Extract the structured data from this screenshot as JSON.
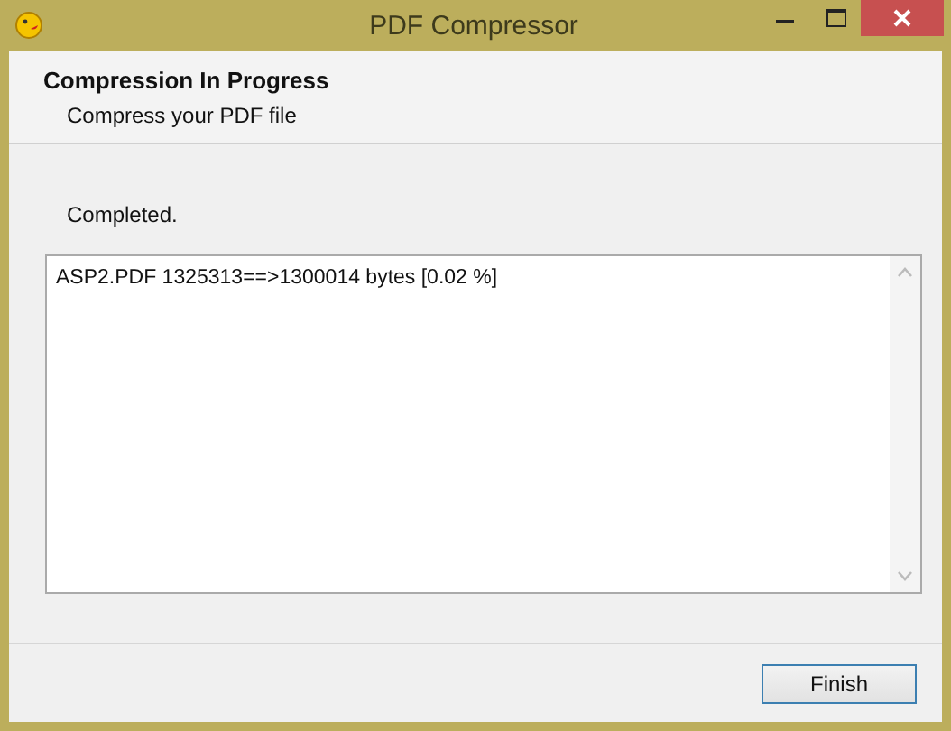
{
  "window": {
    "title": "PDF Compressor"
  },
  "header": {
    "title": "Compression In Progress",
    "subtitle": "Compress your PDF file"
  },
  "status": "Completed.",
  "log": {
    "lines": [
      "ASP2.PDF 1325313==>1300014 bytes [0.02 %]"
    ]
  },
  "buttons": [
    "Finish"
  ]
}
